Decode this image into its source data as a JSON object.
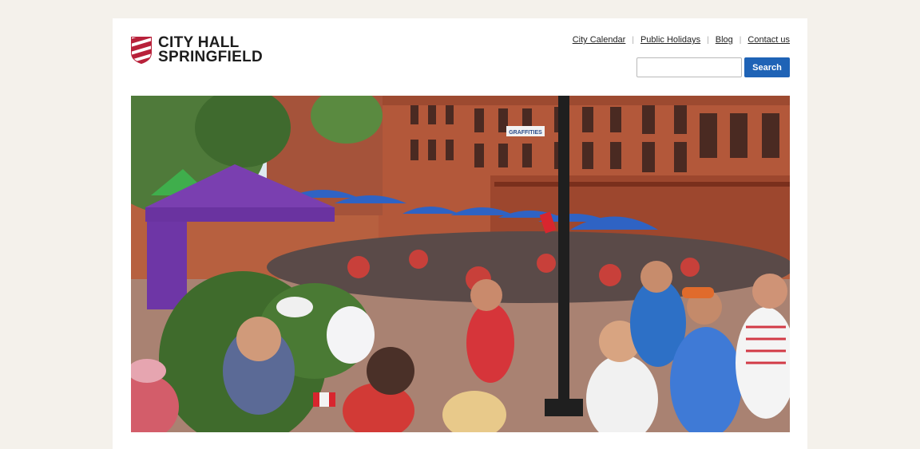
{
  "site": {
    "logo_line1": "CITY HALL",
    "logo_line2": "SPRINGFIELD"
  },
  "nav": {
    "items": [
      {
        "label": "City Calendar"
      },
      {
        "label": "Public Holidays"
      },
      {
        "label": "Blog"
      },
      {
        "label": "Contact us"
      }
    ],
    "separator": "|"
  },
  "search": {
    "input_value": "",
    "placeholder": "",
    "button_label": "Search"
  },
  "hero": {
    "image": "festival-crowd-photo",
    "sign_text": "GRAFFITIES"
  },
  "colors": {
    "page_background": "#f4f1eb",
    "accent_blue": "#1f63b6",
    "logo_red": "#b8213a"
  }
}
